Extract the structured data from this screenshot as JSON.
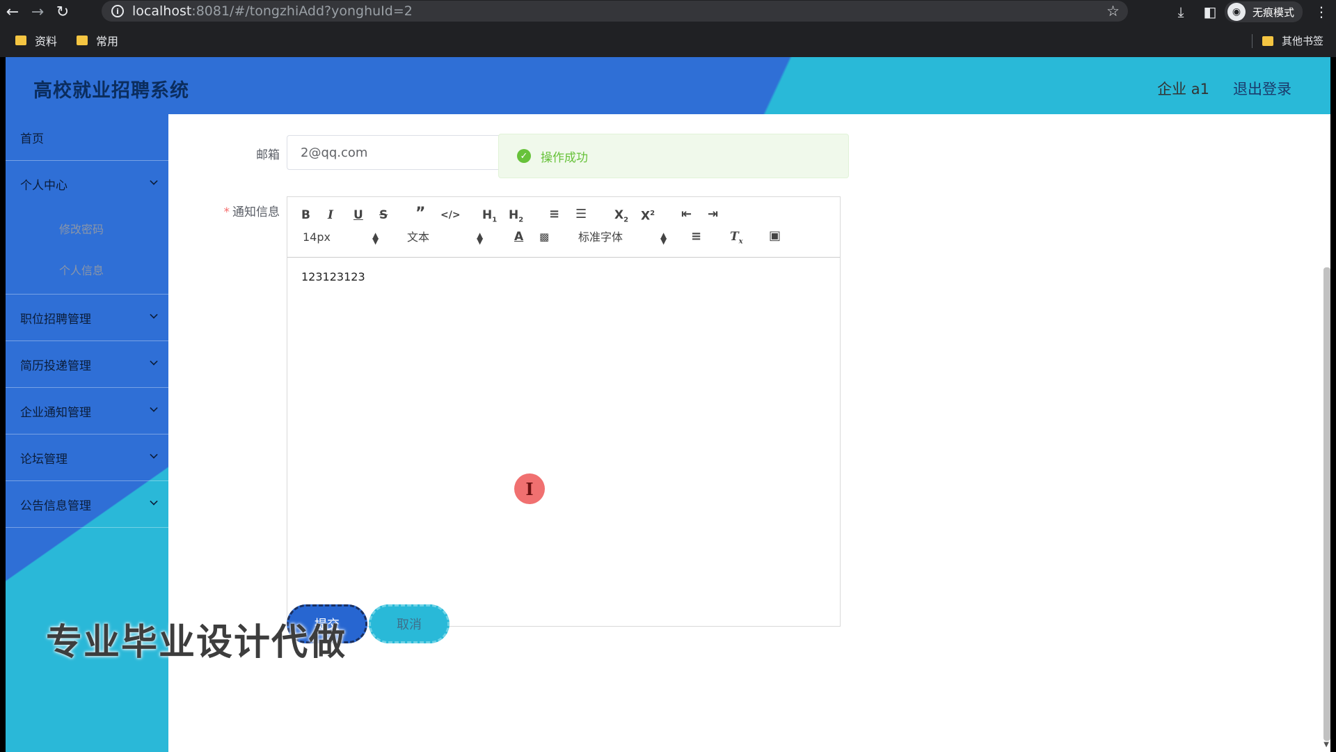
{
  "browser": {
    "url_host": "localhost",
    "url_rest": ":8081/#/tongzhiAdd?yonghuId=2",
    "incognito_label": "无痕模式",
    "bookmarks": [
      "资料",
      "常用"
    ],
    "other_bookmarks": "其他书签"
  },
  "header": {
    "title": "高校就业招聘系统",
    "user": "企业 a1",
    "logout": "退出登录"
  },
  "sidebar": {
    "home": "首页",
    "personal_center": "个人中心",
    "sub_change_password": "修改密码",
    "sub_personal_info": "个人信息",
    "job_management": "职位招聘管理",
    "resume_management": "简历投递管理",
    "notice_management": "企业通知管理",
    "forum_management": "论坛管理",
    "announcement_management": "公告信息管理"
  },
  "form": {
    "email_label": "邮箱",
    "email_value": "2@qq.com",
    "required_mark": "*",
    "notice_label": "通知信息",
    "editor_content": "123123123",
    "toolbar": {
      "font_size": "14px",
      "header": "文本",
      "font": "标准字体"
    },
    "submit": "提交",
    "cancel": "取消"
  },
  "toast": {
    "message": "操作成功"
  },
  "watermark": "专业毕业设计代做",
  "cursor_glyph": "I",
  "colors": {
    "primary": "#2f6fd6",
    "accent": "#29b9d8",
    "success": "#67c23a"
  }
}
